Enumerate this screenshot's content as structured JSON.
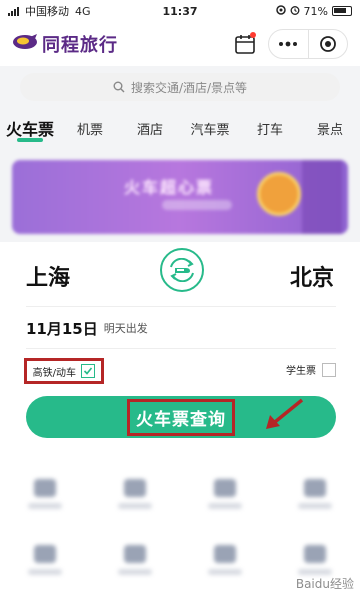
{
  "status": {
    "carrier": "中国移动",
    "network": "4G",
    "time": "11:37",
    "battery": "71%"
  },
  "app": {
    "name": "同程旅行"
  },
  "search": {
    "placeholder": "搜索交通/酒店/景点等"
  },
  "tabs": [
    {
      "label": "火车票",
      "active": true
    },
    {
      "label": "机票"
    },
    {
      "label": "酒店"
    },
    {
      "label": "汽车票"
    },
    {
      "label": "打车"
    },
    {
      "label": "景点"
    }
  ],
  "banner": {
    "title": "火车超心票"
  },
  "trip": {
    "from": "上海",
    "to": "北京",
    "date": "11月15日",
    "date_note": "明天出发",
    "high_speed_label": "高铁/动车",
    "high_speed_checked": true,
    "student_label": "学生票",
    "student_checked": false,
    "query_label": "火车票查询"
  },
  "watermark": "Baidu经验",
  "colors": {
    "accent": "#27ba8a",
    "brand": "#5b2a86",
    "highlight": "#b52626"
  }
}
